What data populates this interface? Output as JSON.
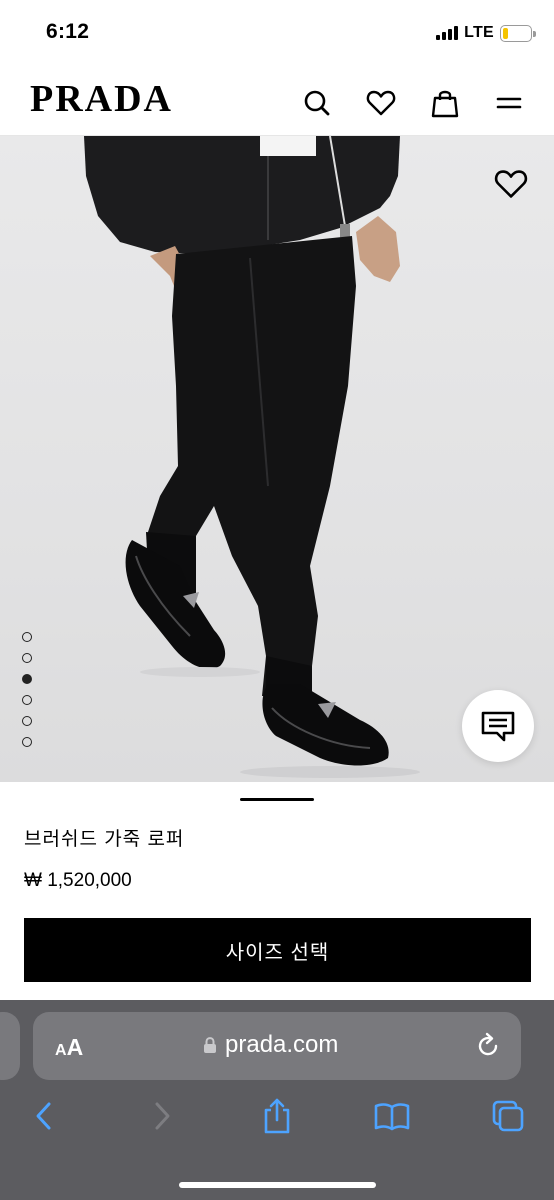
{
  "status_bar": {
    "time": "6:12",
    "network": "LTE",
    "battery_level_fraction": 0.18,
    "battery_color": "#f5c400"
  },
  "header": {
    "logo": "PRADA",
    "icons": [
      "search-icon",
      "heart-icon",
      "bag-icon",
      "menu-icon"
    ]
  },
  "gallery": {
    "wishlist_icon": "heart-outline-icon",
    "image_count": 6,
    "active_index": 2,
    "chat_icon": "chat-icon",
    "background": "#e4e4e5"
  },
  "product": {
    "name": "브러쉬드 가죽 로퍼",
    "price": "₩ 1,520,000",
    "size_button_label": "사이즈 선택"
  },
  "safari": {
    "aa_small": "A",
    "aa_big": "A",
    "url": "prada.com",
    "toolbar_icons": [
      "back-icon",
      "forward-icon",
      "share-icon",
      "bookmarks-icon",
      "tabs-icon"
    ],
    "accent": "#4da3ff"
  }
}
